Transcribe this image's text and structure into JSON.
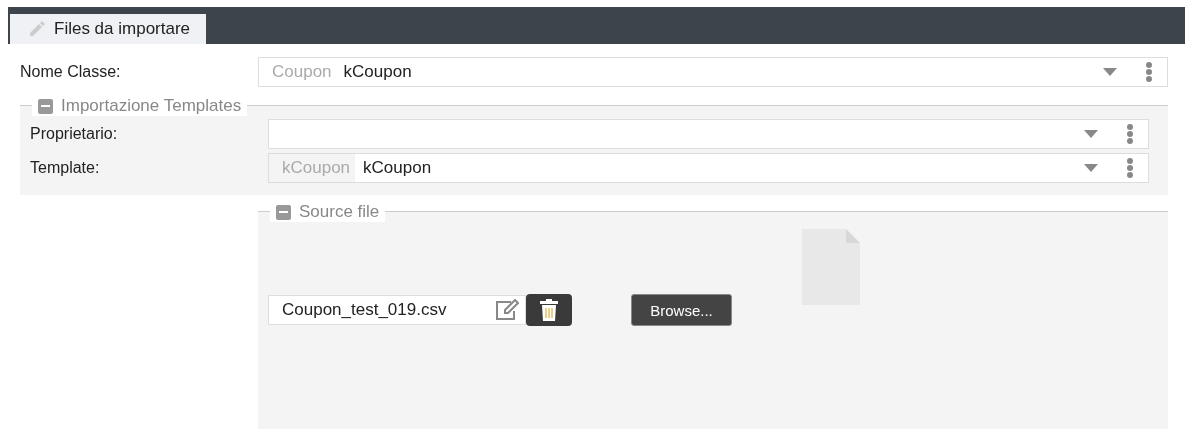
{
  "tab": {
    "label": "Files da importare",
    "selected": true
  },
  "class_field": {
    "label": "Nome Classe:",
    "prefix": "Coupon",
    "value": "kCoupon"
  },
  "templates_group": {
    "title": "Importazione Templates",
    "expanded": true,
    "fields": [
      {
        "label": "Proprietario:"
      },
      {
        "label": "Template:",
        "prefix": "kCoupon",
        "value": "kCoupon"
      }
    ]
  },
  "source_group": {
    "title": "Source file",
    "expanded": true,
    "file_name": "Coupon_test_019.csv",
    "browse_button": "Browse..."
  }
}
